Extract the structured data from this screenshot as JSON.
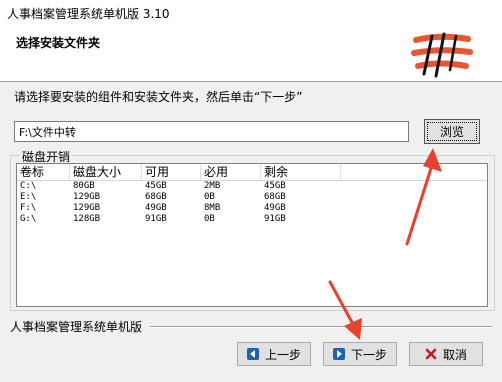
{
  "window": {
    "title": "人事档案管理系统单机版 3.10"
  },
  "header": {
    "title": "选择安装文件夹",
    "logo_icon": "brush-stripes-icon"
  },
  "instruction": "请选择要安装的组件和安装文件夹，然后单击“下一步”",
  "path": {
    "value": "F:\\文件中转",
    "browse_label": "浏览"
  },
  "disk_group": {
    "label": "磁盘开销",
    "columns": [
      "卷标",
      "磁盘大小",
      "可用",
      "必用",
      "剩余"
    ],
    "rows": [
      [
        "C:\\",
        "80GB",
        "45GB",
        "2MB",
        "45GB"
      ],
      [
        "E:\\",
        "129GB",
        "68GB",
        "0B",
        "68GB"
      ],
      [
        "F:\\",
        "129GB",
        "49GB",
        "8MB",
        "49GB"
      ],
      [
        "G:\\",
        "128GB",
        "91GB",
        "0B",
        "91GB"
      ]
    ]
  },
  "footer": {
    "brand": "人事档案管理系统单机版",
    "prev_label": "上一步",
    "next_label": "下一步",
    "cancel_label": "取消"
  },
  "colors": {
    "annotation_arrow": "#e8412c",
    "nav_arrow": "#1f5fb8",
    "cancel_x": "#d01818"
  }
}
